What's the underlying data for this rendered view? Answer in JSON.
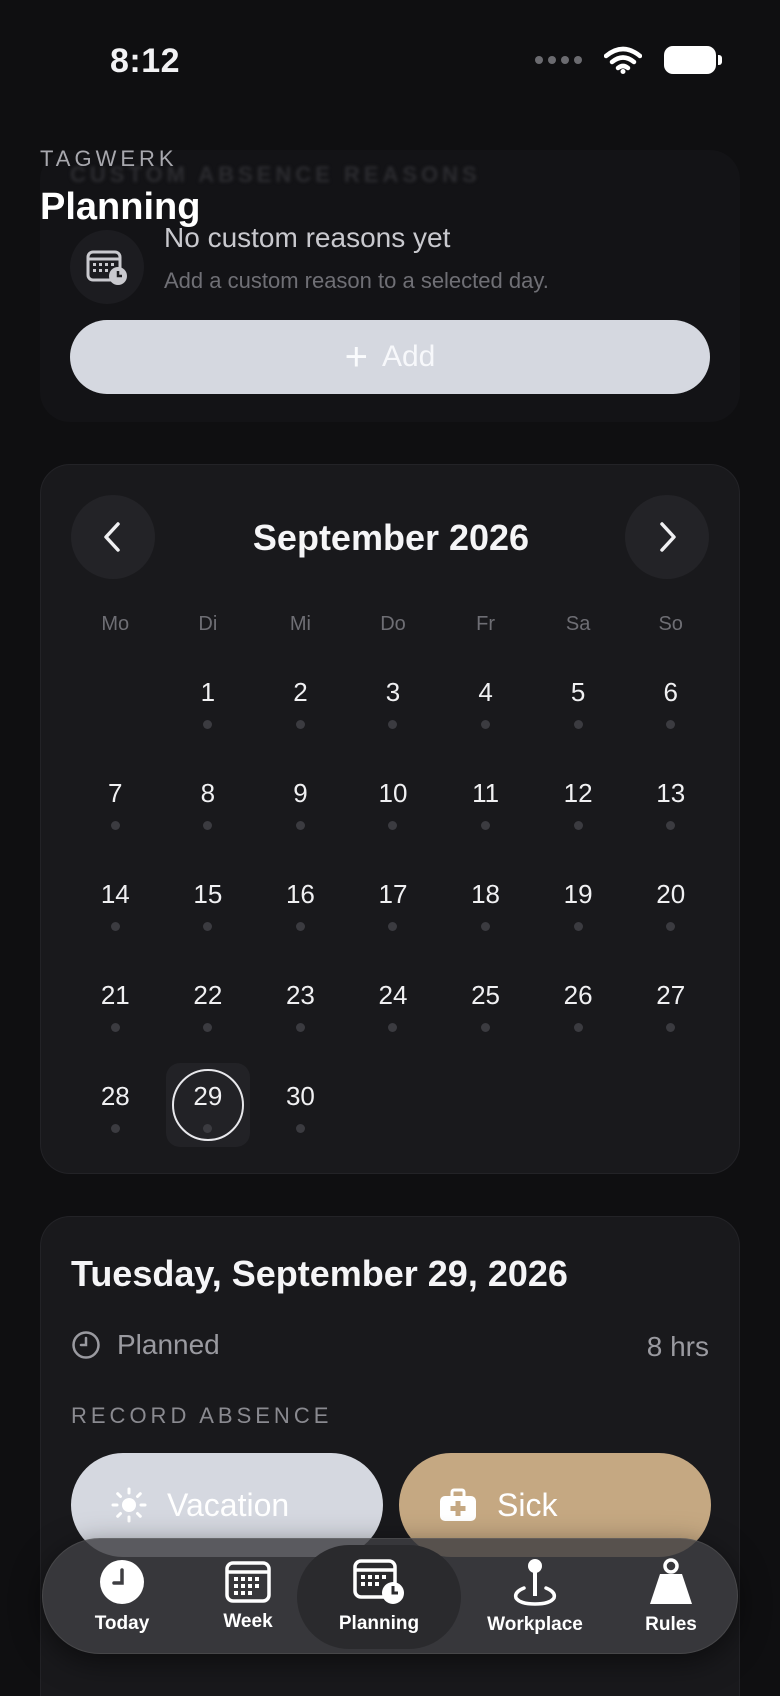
{
  "status_bar": {
    "time": "8:12"
  },
  "header": {
    "brand": "TAGWERK",
    "title": "Planning",
    "behind_text": "CUSTOM ABSENCE REASONS"
  },
  "custom_reasons": {
    "empty_title": "No custom reasons yet",
    "empty_subtitle": "Add a custom reason to a selected day.",
    "add_label": "Add"
  },
  "calendar": {
    "month_label": "September 2026",
    "weekdays": [
      "Mo",
      "Di",
      "Mi",
      "Do",
      "Fr",
      "Sa",
      "So"
    ],
    "days": [
      "",
      "1",
      "2",
      "3",
      "4",
      "5",
      "6",
      "7",
      "8",
      "9",
      "10",
      "11",
      "12",
      "13",
      "14",
      "15",
      "16",
      "17",
      "18",
      "19",
      "20",
      "21",
      "22",
      "23",
      "24",
      "25",
      "26",
      "27",
      "28",
      "29",
      "30"
    ],
    "selected_day": "29"
  },
  "detail": {
    "date_title": "Tuesday, September 29, 2026",
    "planned_label": "Planned",
    "planned_hours": "8 hrs",
    "record_heading": "RECORD ABSENCE",
    "vacation_label": "Vacation",
    "sick_label": "Sick"
  },
  "tabs": [
    {
      "label": "Today",
      "icon": "clock-icon"
    },
    {
      "label": "Week",
      "icon": "calendar-grid-icon"
    },
    {
      "label": "Planning",
      "icon": "calendar-clock-icon",
      "active": true
    },
    {
      "label": "Workplace",
      "icon": "location-pin-icon"
    },
    {
      "label": "Rules",
      "icon": "weight-icon"
    }
  ],
  "colors": {
    "background": "#0f0f11",
    "card": "#19191c",
    "vacation_button": "#d5d8e0",
    "sick_button": "#c5a882"
  }
}
